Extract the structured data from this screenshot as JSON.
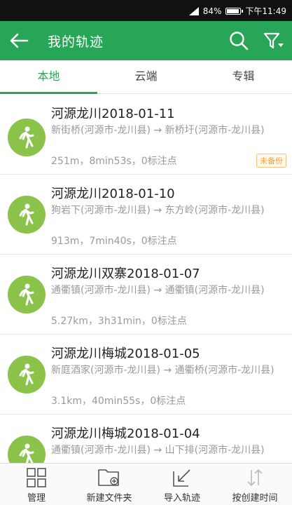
{
  "statusbar": {
    "battery": "84%",
    "time": "下午11:49"
  },
  "appbar": {
    "title": "我的轨迹"
  },
  "tabs": [
    {
      "label": "本地",
      "active": true
    },
    {
      "label": "云端",
      "active": false
    },
    {
      "label": "专辑",
      "active": false
    }
  ],
  "tracks": [
    {
      "title": "河源龙川2018-01-11",
      "route": "新街桥(河源市-龙川县) → 新桥圩(河源市-龙川县)",
      "stats": "251m，8min53s，0标注点",
      "badge": "未备份"
    },
    {
      "title": "河源龙川2018-01-10",
      "route": "狗岩下(河源市-龙川县) → 东方岭(河源市-龙川县)",
      "stats": "913m，7min40s，0标注点",
      "badge": ""
    },
    {
      "title": "河源龙川双寨2018-01-07",
      "route": "通衢镇(河源市-龙川县) → 通衢镇(河源市-龙川县)",
      "stats": "5.27km，3h31min，0标注点",
      "badge": ""
    },
    {
      "title": "河源龙川梅城2018-01-05",
      "route": "新庭酒家(河源市-龙川县) → 通衢桥(河源市-龙川县)",
      "stats": "3.1km，40min55s，0标注点",
      "badge": ""
    },
    {
      "title": "河源龙川梅城2018-01-04",
      "route": "通衢镇(河源市-龙川县) → 山下排(河源市-龙川县)",
      "stats": "",
      "badge": ""
    }
  ],
  "bottombar": [
    {
      "label": "管理",
      "icon": "grid-icon"
    },
    {
      "label": "新建文件夹",
      "icon": "new-folder-icon"
    },
    {
      "label": "导入轨迹",
      "icon": "import-icon"
    },
    {
      "label": "按创建时间",
      "icon": "sort-icon"
    }
  ],
  "colors": {
    "primary": "#28a658",
    "avatar": "#8bc34a",
    "badge": "#f0a43a"
  }
}
